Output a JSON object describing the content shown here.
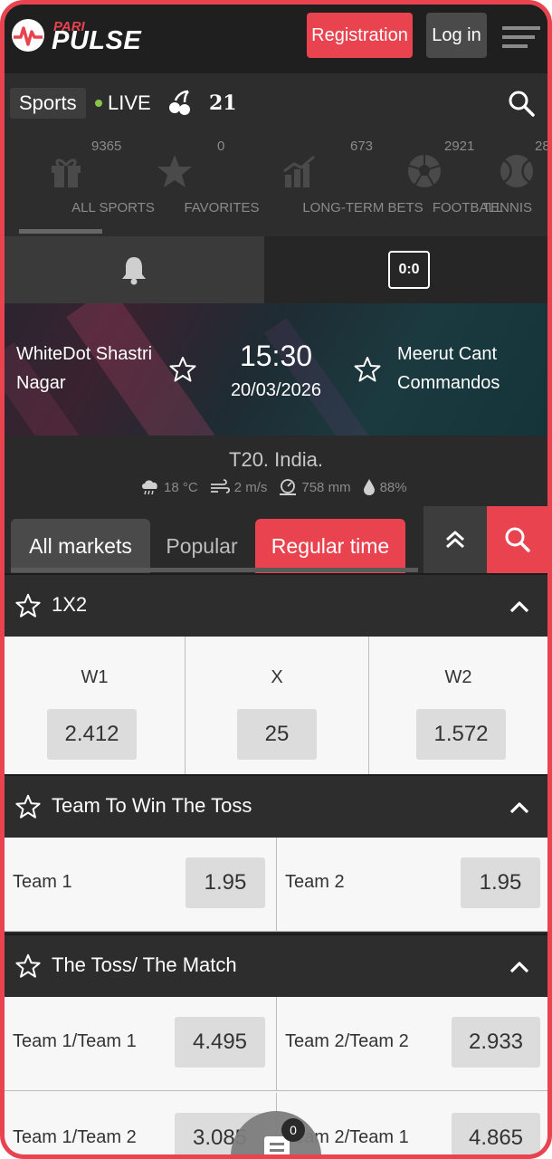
{
  "header": {
    "logo_top": "PARI",
    "logo_main": "PULSE",
    "register_label": "Registration",
    "login_label": "Log in",
    "menu_icon": "hamburger-menu-icon"
  },
  "nav": {
    "sports_label": "Sports",
    "live_label": "LIVE",
    "slots_icon": "cherry-icon",
    "blackjack_label": "21",
    "search_icon": "search-icon"
  },
  "categories": [
    {
      "count": "9365",
      "label": "ALL SPORTS",
      "icon": "gift-icon"
    },
    {
      "count": "0",
      "label": "FAVORITES",
      "icon": "star-icon"
    },
    {
      "count": "673",
      "label": "LONG-TERM BETS",
      "icon": "bar-chart-icon"
    },
    {
      "count": "2921",
      "label": "FOOTBALL",
      "icon": "football-icon"
    },
    {
      "count": "28",
      "label": "TENNIS",
      "icon": "tennis-ball-icon"
    }
  ],
  "subtabs": {
    "notifications_icon": "bell-icon",
    "score_label": "0:0"
  },
  "match": {
    "team1": "WhiteDot Shastri Nagar",
    "team2": "Meerut Cant Commandos",
    "time": "15:30",
    "date": "20/03/2026"
  },
  "league": {
    "title": "T20. India.",
    "temperature": "18 °C",
    "wind": "2 m/s",
    "pressure": "758 mm",
    "humidity": "88%"
  },
  "market_tabs": {
    "all": "All markets",
    "popular": "Popular",
    "regular": "Regular time",
    "active": "Regular time"
  },
  "markets": [
    {
      "title": "1X2",
      "outcomes": [
        {
          "label": "W1",
          "odd": "2.412"
        },
        {
          "label": "X",
          "odd": "25"
        },
        {
          "label": "W2",
          "odd": "1.572"
        }
      ]
    },
    {
      "title": "Team To Win The Toss",
      "outcomes": [
        {
          "label": "Team 1",
          "odd": "1.95"
        },
        {
          "label": "Team 2",
          "odd": "1.95"
        }
      ]
    },
    {
      "title": "The Toss/ The Match",
      "outcomes": [
        {
          "label": "Team 1/Team 1",
          "odd": "4.495"
        },
        {
          "label": "Team 2/Team 2",
          "odd": "2.933"
        },
        {
          "label": "Team 1/Team 2",
          "odd": "3.085"
        },
        {
          "label": "Team 2/Team 1",
          "odd": "4.865"
        }
      ]
    }
  ],
  "coupon": {
    "count": "0"
  },
  "colors": {
    "accent": "#e8434f",
    "dark": "#2d2d2d",
    "live_dot": "#8bc34a"
  }
}
